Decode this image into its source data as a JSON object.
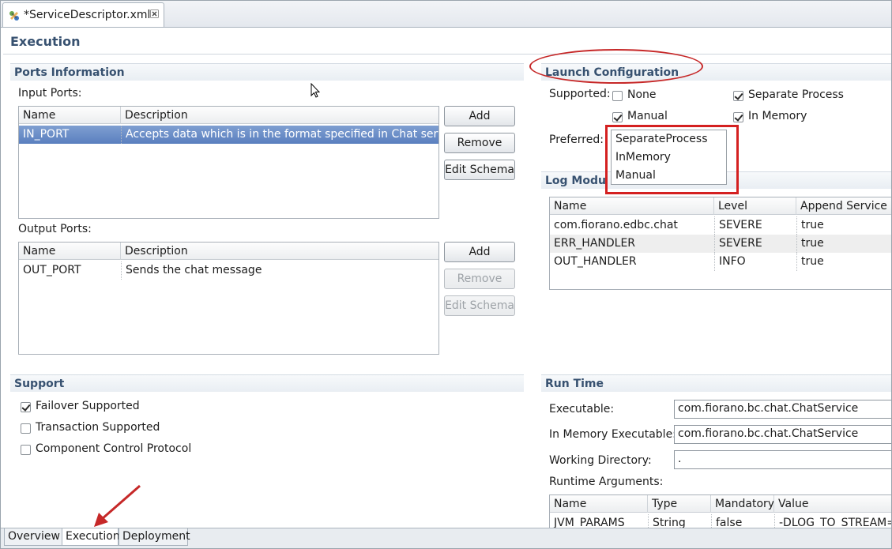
{
  "editor": {
    "tab_title": "*ServiceDescriptor.xml",
    "page_title": "Execution"
  },
  "ports": {
    "header": "Ports Information",
    "input_label": "Input Ports:",
    "output_label": "Output Ports:",
    "columns": [
      "Name",
      "Description"
    ],
    "input_rows": [
      {
        "name": "IN_PORT",
        "description": "Accepts data which is in the format specified in Chat service"
      }
    ],
    "output_rows": [
      {
        "name": "OUT_PORT",
        "description": "Sends the chat message"
      }
    ],
    "buttons": {
      "add": "Add",
      "remove": "Remove",
      "edit_schema": "Edit Schema"
    }
  },
  "launch": {
    "header": "Launch Configuration",
    "supported_label": "Supported:",
    "preferred_label": "Preferred:",
    "options": [
      {
        "label": "None",
        "checked": false
      },
      {
        "label": "Separate Process",
        "checked": true
      },
      {
        "label": "Manual",
        "checked": true
      },
      {
        "label": "In Memory",
        "checked": true
      }
    ],
    "preferred_list": [
      "SeparateProcess",
      "InMemory",
      "Manual"
    ],
    "highlight_color": "#d42020"
  },
  "log_modules": {
    "header": "Log Modu",
    "columns": [
      "Name",
      "Level",
      "Append Service In"
    ],
    "rows": [
      {
        "name": "com.fiorano.edbc.chat",
        "level": "SEVERE",
        "append": "true"
      },
      {
        "name": "ERR_HANDLER",
        "level": "SEVERE",
        "append": "true"
      },
      {
        "name": "OUT_HANDLER",
        "level": "INFO",
        "append": "true"
      }
    ]
  },
  "support": {
    "header": "Support",
    "options": [
      {
        "label": "Failover Supported",
        "checked": true
      },
      {
        "label": "Transaction Supported",
        "checked": false
      },
      {
        "label": "Component Control Protocol",
        "checked": false
      }
    ]
  },
  "runtime": {
    "header": "Run Time",
    "executable_label": "Executable:",
    "executable_value": "com.fiorano.bc.chat.ChatService",
    "inmemory_label": "In Memory Executable:",
    "inmemory_value": "com.fiorano.bc.chat.ChatService",
    "workdir_label": "Working Directory:",
    "workdir_value": ".",
    "args_label": "Runtime Arguments:",
    "columns": [
      "Name",
      "Type",
      "Mandatory",
      "Value"
    ],
    "rows": [
      {
        "name": "JVM_PARAMS",
        "type": "String",
        "mandatory": "false",
        "value": "-DLOG_TO_STREAM="
      }
    ]
  },
  "bottom_tabs": [
    "Overview",
    "Execution",
    "Deployment"
  ],
  "active_bottom_tab": "Execution",
  "accent_color": "#375170",
  "selection_color": "#5a7fbf"
}
